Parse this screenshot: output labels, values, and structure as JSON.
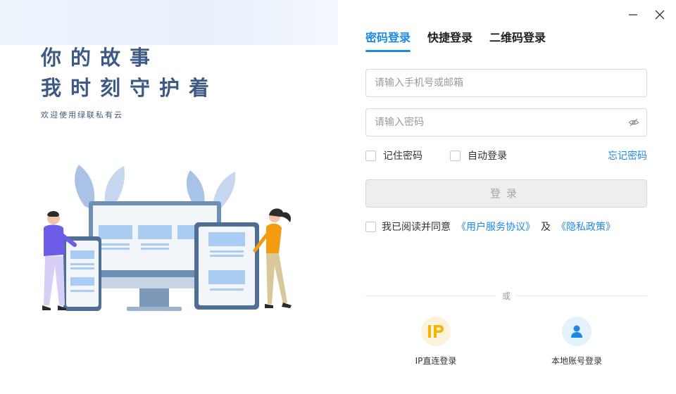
{
  "window": {
    "minimize_icon": "minimize-icon",
    "close_icon": "close-icon"
  },
  "hero": {
    "line1": "你的故事",
    "line2": "我时刻守护着",
    "subtitle": "欢迎使用绿联私有云"
  },
  "tabs": [
    {
      "label": "密码登录",
      "active": true
    },
    {
      "label": "快捷登录",
      "active": false
    },
    {
      "label": "二维码登录",
      "active": false
    }
  ],
  "form": {
    "account_placeholder": "请输入手机号或邮箱",
    "account_value": "",
    "password_placeholder": "请输入密码",
    "password_value": "",
    "remember_label": "记住密码",
    "remember_checked": false,
    "auto_login_label": "自动登录",
    "auto_login_checked": false,
    "forgot_label": "忘记密码",
    "submit_label": "登录",
    "agree_prefix": "我已阅读并同意",
    "agree_checked": false,
    "terms_link": "《用户服务协议》",
    "and_text": "及",
    "privacy_link": "《隐私政策》"
  },
  "divider_label": "或",
  "alt_logins": [
    {
      "label": "IP直连登录",
      "icon": "ip-icon"
    },
    {
      "label": "本地账号登录",
      "icon": "user-icon"
    }
  ],
  "colors": {
    "accent": "#1e88e5",
    "hero_text": "#3d5a86"
  }
}
